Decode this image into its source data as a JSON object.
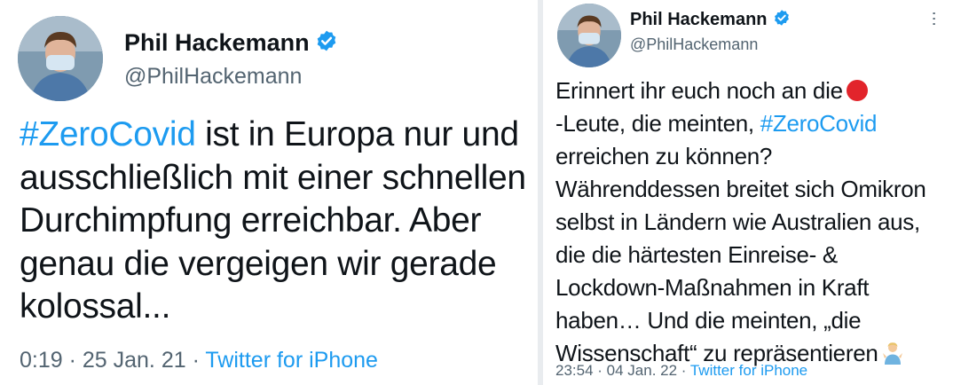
{
  "left_tweet": {
    "author_name": "Phil Hackemann",
    "author_handle": "@PhilHackemann",
    "text": {
      "line1_hashtag": "#ZeroCovid",
      "line1_rest": " ist in Europa nur und",
      "line2": "ausschließlich mit einer schnellen",
      "line3": "Durchimpfung erreichbar. Aber",
      "line4": "genau die vergeigen wir gerade",
      "line5": "kolossal..."
    },
    "timestamp": "0:19 · 25 Jan. 21 · ",
    "source": "Twitter for iPhone"
  },
  "right_tweet": {
    "author_name": "Phil Hackemann",
    "author_handle": "@PhilHackemann",
    "text": {
      "line1": "Erinnert ihr euch noch an die",
      "line2_pre": "-Leute, die meinten, ",
      "line2_hashtag": "#ZeroCovid",
      "line3": "erreichen zu können?",
      "line4": "Währenddessen breitet sich Omikron",
      "line5": "selbst in Ländern wie Australien aus,",
      "line6": "die die härtesten Einreise- &",
      "line7": "Lockdown-Maßnahmen in Kraft",
      "line8": "haben… Und die meinten, „die",
      "line9": "Wissenschaft“ zu repräsentieren"
    },
    "timestamp": "23:54 · 04 Jan. 22 · ",
    "source": "Twitter for iPhone",
    "more_icon": "more-dots-icon"
  },
  "colors": {
    "hashtag": "#1d9bf0",
    "verified_badge": "#1d9bf0",
    "secondary_text": "#536471",
    "red_circle_emoji": "#e2242b"
  }
}
